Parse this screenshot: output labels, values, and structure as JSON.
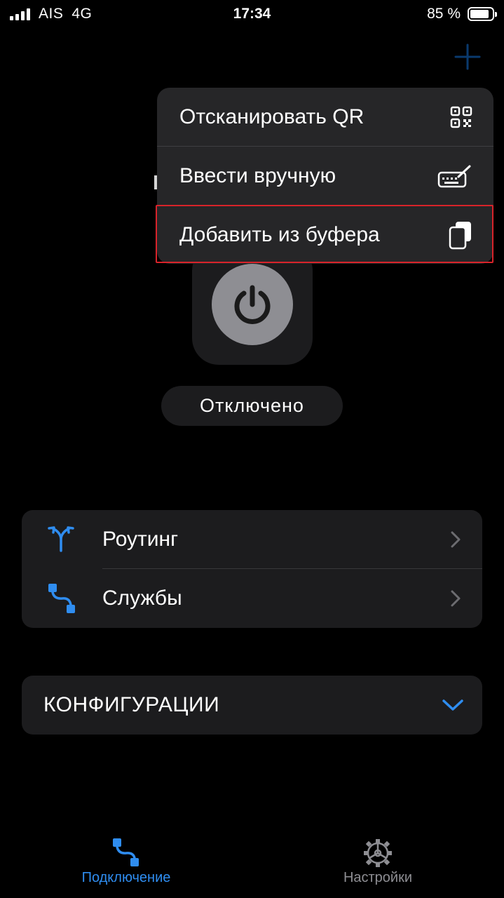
{
  "status_bar": {
    "carrier": "AIS",
    "network": "4G",
    "time": "17:34",
    "battery_percent": "85 %",
    "battery_level": 0.85
  },
  "colors": {
    "accent": "#2f8df0",
    "highlight_border": "#d8232a",
    "menu_bg": "#262628",
    "card_bg": "#1c1c1e",
    "power_idle": "#8e8e93"
  },
  "header": {
    "add_icon": "plus-icon"
  },
  "menu": {
    "items": [
      {
        "label": "Отсканировать QR",
        "icon": "qr-code-icon"
      },
      {
        "label": "Ввести вручную",
        "icon": "keyboard-pen-icon"
      },
      {
        "label": "Добавить из буфера",
        "icon": "clipboard-icon",
        "highlighted": true
      }
    ]
  },
  "connection": {
    "power_icon": "power-icon",
    "status": "Отключено"
  },
  "list": {
    "items": [
      {
        "label": "Роутинг",
        "icon": "routing-icon"
      },
      {
        "label": "Службы",
        "icon": "services-icon"
      }
    ]
  },
  "configurations": {
    "label": "КОНФИГУРАЦИИ",
    "expanded": false
  },
  "tabbar": {
    "tabs": [
      {
        "label": "Подключение",
        "icon": "connection-icon",
        "active": true
      },
      {
        "label": "Настройки",
        "icon": "gear-icon",
        "active": false
      }
    ]
  }
}
